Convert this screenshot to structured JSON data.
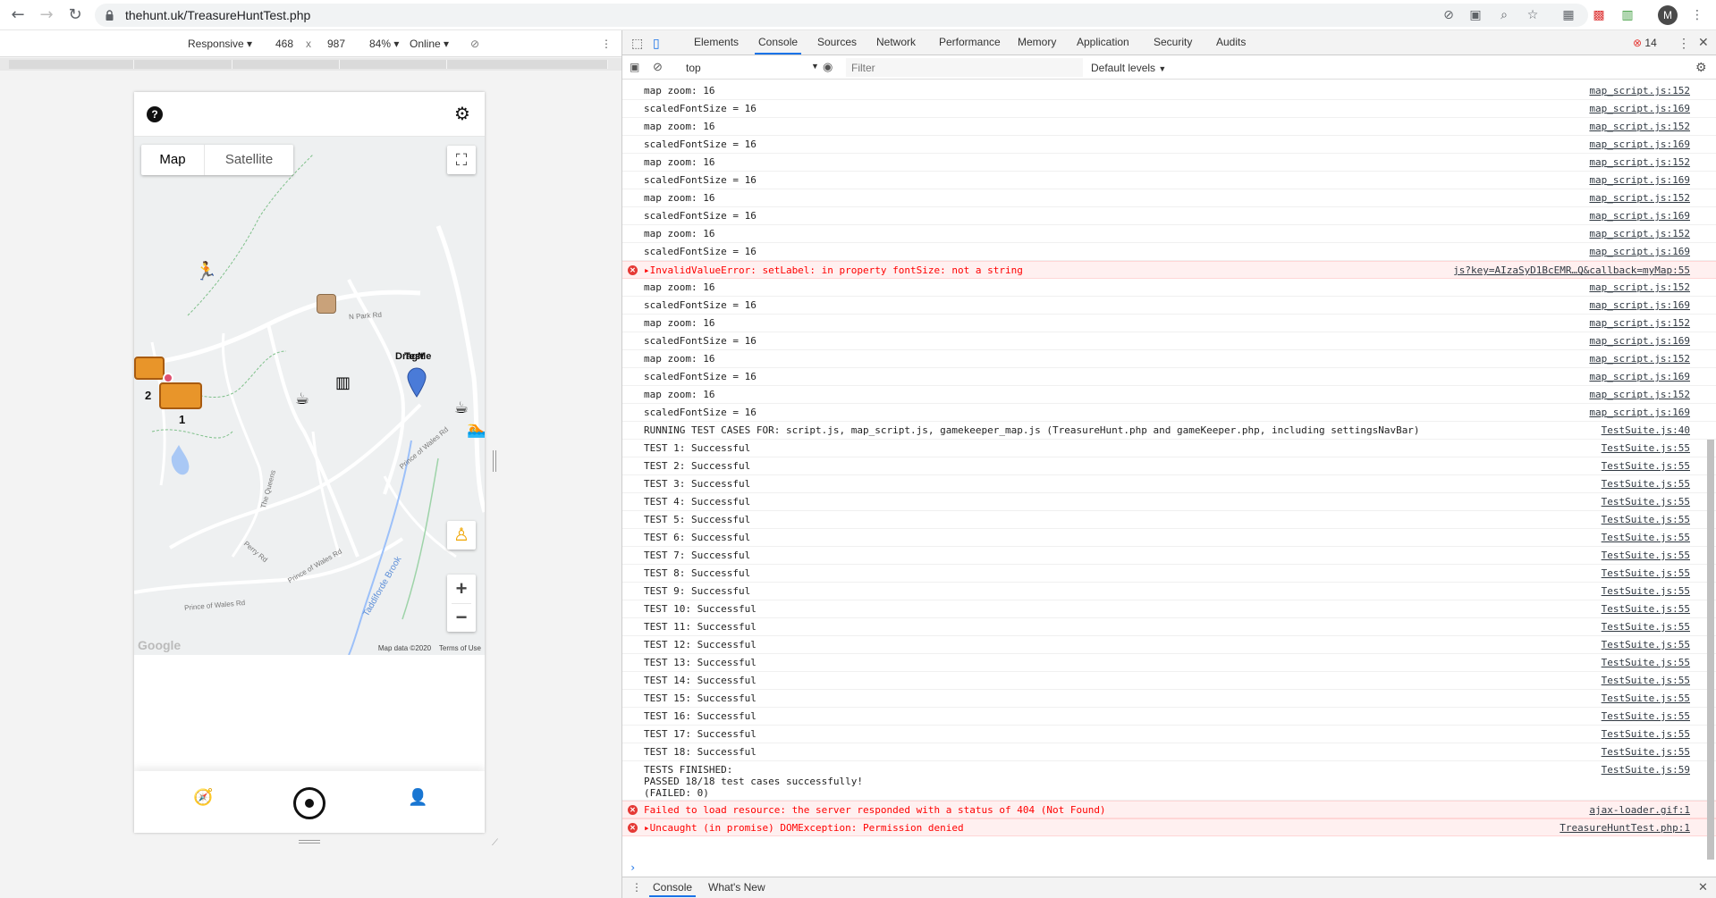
{
  "browser": {
    "url": "thehunt.uk/TreasureHuntTest.php",
    "avatar_letter": "M"
  },
  "device_toolbar": {
    "mode": "Responsive",
    "width": "468",
    "times": "x",
    "height": "987",
    "zoom": "84%",
    "network": "Online"
  },
  "app": {
    "map_type_map": "Map",
    "map_type_satellite": "Satellite",
    "map_labels": {
      "n_park_rd": "N Park Rd",
      "drag_me": "DragMe",
      "test_label": "Test",
      "prince_of_wales_rd_1": "Prince of Wales Rd",
      "prince_of_wales_rd_2": "Prince of Wales Rd",
      "prince_of_wales_rd_3": "Prince of Wales Rd",
      "taddiforde_brook": "Taddiforde Brook",
      "the_queens": "The Queens",
      "perry_rd": "Perry Rd",
      "cluster_count_a": "2",
      "cluster_count_b": "1"
    },
    "google": "Google",
    "map_data": "Map data ©2020",
    "terms": "Terms of Use",
    "zoom_in": "+",
    "zoom_out": "−"
  },
  "devtools": {
    "tabs": [
      "Elements",
      "Console",
      "Sources",
      "Network",
      "Performance",
      "Memory",
      "Application",
      "Security",
      "Audits"
    ],
    "active_tab": "Console",
    "error_count": "14",
    "context": "top",
    "filter_placeholder": "Filter",
    "levels": "Default levels",
    "drawer_tabs": [
      "Console",
      "What's New"
    ],
    "log": [
      {
        "msg": "map zoom: 16",
        "src": "map_script.js:152",
        "type": "log"
      },
      {
        "msg": "scaledFontSize = 16",
        "src": "map_script.js:169",
        "type": "log"
      },
      {
        "msg": "map zoom: 16",
        "src": "map_script.js:152",
        "type": "log"
      },
      {
        "msg": "scaledFontSize = 16",
        "src": "map_script.js:169",
        "type": "log"
      },
      {
        "msg": "map zoom: 16",
        "src": "map_script.js:152",
        "type": "log"
      },
      {
        "msg": "scaledFontSize = 16",
        "src": "map_script.js:169",
        "type": "log"
      },
      {
        "msg": "map zoom: 16",
        "src": "map_script.js:152",
        "type": "log"
      },
      {
        "msg": "scaledFontSize = 16",
        "src": "map_script.js:169",
        "type": "log"
      },
      {
        "msg": "map zoom: 16",
        "src": "map_script.js:152",
        "type": "log"
      },
      {
        "msg": "scaledFontSize = 16",
        "src": "map_script.js:169",
        "type": "log"
      },
      {
        "msg": "▸InvalidValueError: setLabel: in property fontSize: not a string",
        "src": "js?key=AIzaSyD1BcEMR…Q&callback=myMap:55",
        "type": "error"
      },
      {
        "msg": "map zoom: 16",
        "src": "map_script.js:152",
        "type": "log"
      },
      {
        "msg": "scaledFontSize = 16",
        "src": "map_script.js:169",
        "type": "log"
      },
      {
        "msg": "map zoom: 16",
        "src": "map_script.js:152",
        "type": "log"
      },
      {
        "msg": "scaledFontSize = 16",
        "src": "map_script.js:169",
        "type": "log"
      },
      {
        "msg": "map zoom: 16",
        "src": "map_script.js:152",
        "type": "log"
      },
      {
        "msg": "scaledFontSize = 16",
        "src": "map_script.js:169",
        "type": "log"
      },
      {
        "msg": "map zoom: 16",
        "src": "map_script.js:152",
        "type": "log"
      },
      {
        "msg": "scaledFontSize = 16",
        "src": "map_script.js:169",
        "type": "log"
      },
      {
        "msg": "RUNNING TEST CASES FOR: script.js, map_script.js, gamekeeper_map.js (TreasureHunt.php and gameKeeper.php, including settingsNavBar)",
        "src": "TestSuite.js:40",
        "type": "log"
      },
      {
        "msg": "TEST 1: Successful",
        "src": "TestSuite.js:55",
        "type": "log"
      },
      {
        "msg": "TEST 2: Successful",
        "src": "TestSuite.js:55",
        "type": "log"
      },
      {
        "msg": "TEST 3: Successful",
        "src": "TestSuite.js:55",
        "type": "log"
      },
      {
        "msg": "TEST 4: Successful",
        "src": "TestSuite.js:55",
        "type": "log"
      },
      {
        "msg": "TEST 5: Successful",
        "src": "TestSuite.js:55",
        "type": "log"
      },
      {
        "msg": "TEST 6: Successful",
        "src": "TestSuite.js:55",
        "type": "log"
      },
      {
        "msg": "TEST 7: Successful",
        "src": "TestSuite.js:55",
        "type": "log"
      },
      {
        "msg": "TEST 8: Successful",
        "src": "TestSuite.js:55",
        "type": "log"
      },
      {
        "msg": "TEST 9: Successful",
        "src": "TestSuite.js:55",
        "type": "log"
      },
      {
        "msg": "TEST 10: Successful",
        "src": "TestSuite.js:55",
        "type": "log"
      },
      {
        "msg": "TEST 11: Successful",
        "src": "TestSuite.js:55",
        "type": "log"
      },
      {
        "msg": "TEST 12: Successful",
        "src": "TestSuite.js:55",
        "type": "log"
      },
      {
        "msg": "TEST 13: Successful",
        "src": "TestSuite.js:55",
        "type": "log"
      },
      {
        "msg": "TEST 14: Successful",
        "src": "TestSuite.js:55",
        "type": "log"
      },
      {
        "msg": "TEST 15: Successful",
        "src": "TestSuite.js:55",
        "type": "log"
      },
      {
        "msg": "TEST 16: Successful",
        "src": "TestSuite.js:55",
        "type": "log"
      },
      {
        "msg": "TEST 17: Successful",
        "src": "TestSuite.js:55",
        "type": "log"
      },
      {
        "msg": "TEST 18: Successful",
        "src": "TestSuite.js:55",
        "type": "log"
      },
      {
        "msg": "TESTS FINISHED:\nPASSED 18/18 test cases successfully!\n(FAILED: 0)",
        "src": "TestSuite.js:59",
        "type": "tall"
      },
      {
        "msg": "Failed to load resource: the server responded with a status of 404 (Not Found)",
        "src": "ajax-loader.gif:1",
        "type": "error"
      },
      {
        "msg": "▸Uncaught (in promise) DOMException: Permission denied",
        "src": "TreasureHuntTest.php:1",
        "type": "error"
      }
    ],
    "prompt": "›"
  },
  "colors": {
    "accent": "#1a73e8",
    "error": "#e53935",
    "map_bg": "#eef0f1"
  }
}
